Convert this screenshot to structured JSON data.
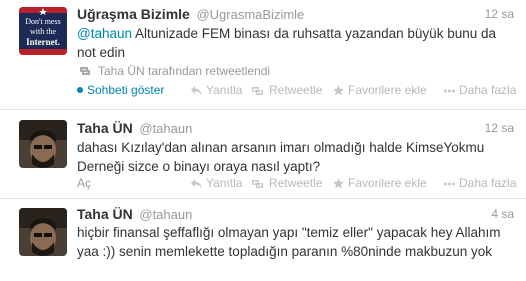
{
  "tweets": [
    {
      "fullname": "Uğraşma Bizimle",
      "username": "@UgrasmaBizimle",
      "time": "12 sa",
      "mention": "@tahaun",
      "text": " Altunizade FEM binası da ruhsatta yazandan büyük bunu da not edin",
      "avatar_text": [
        "Don't mess",
        "with the",
        "Internet."
      ],
      "retweeted_by": "Taha ÜN tarafından retweetlendi",
      "expand_label": "Sohbeti göster",
      "actions": {
        "reply": "Yanıtla",
        "retweet": "Retweetle",
        "favorite": "Favorilere ekle",
        "more": "Daha fazla"
      }
    },
    {
      "fullname": "Taha ÜN",
      "username": "@tahaun",
      "time": "12 sa",
      "text": "dahası Kızılay'dan alınan arsanın imarı olmadığı halde KimseYokmu Derneği sizce o binayı oraya nasıl yaptı?",
      "expand_label": "Aç",
      "actions": {
        "reply": "Yanıtla",
        "retweet": "Retweetle",
        "favorite": "Favorilere ekle",
        "more": "Daha fazla"
      }
    },
    {
      "fullname": "Taha ÜN",
      "username": "@tahaun",
      "time": "4 sa",
      "text": "hiçbir finansal şeffaflığı olmayan yapı \"temiz eller\" yapacak hey Allahım yaa :)) senin memlekette topladığın paranın %80ninde makbuzun yok"
    }
  ],
  "colors": {
    "link": "#0084b4",
    "muted": "#999999",
    "border": "#e8e8e8"
  }
}
